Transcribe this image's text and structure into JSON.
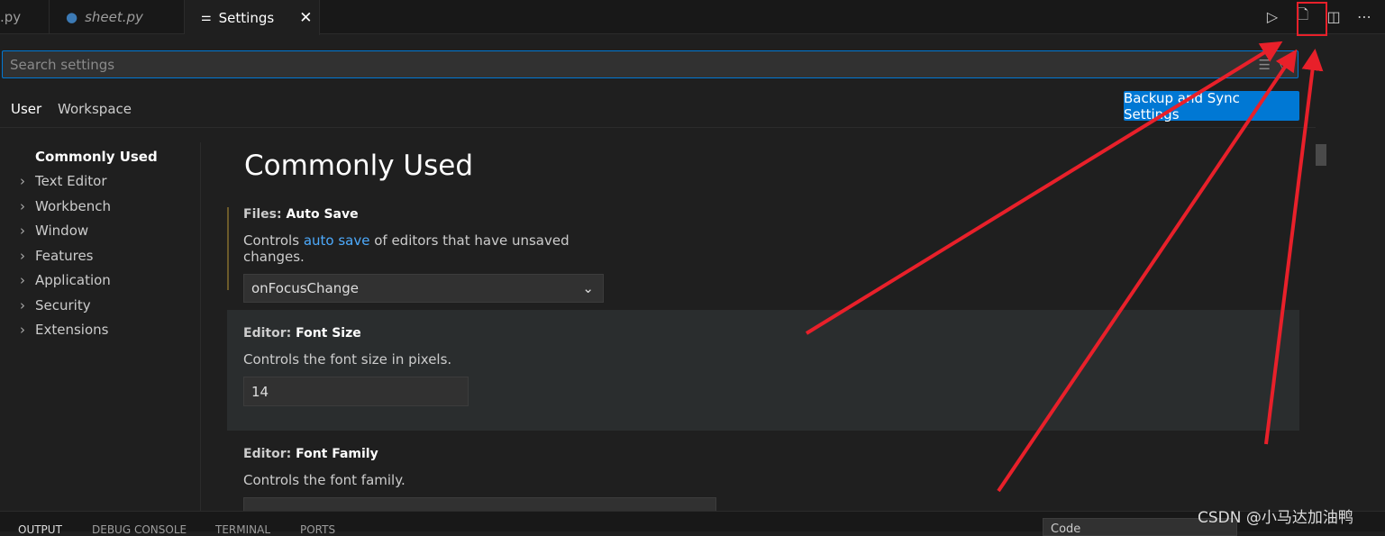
{
  "tabs": [
    {
      "label": ".py",
      "italic": false
    },
    {
      "label": "sheet.py",
      "italic": true,
      "icon": "python-icon"
    },
    {
      "label": "Settings",
      "active": true,
      "icon": "settings-sliders-icon"
    }
  ],
  "editor_actions": [
    "run-icon",
    "open-settings-json-icon",
    "split-editor-icon",
    "more-actions-icon"
  ],
  "search": {
    "placeholder": "Search settings"
  },
  "scopes": {
    "user": "User",
    "workspace": "Workspace"
  },
  "sync_button": "Backup and Sync Settings",
  "toc": [
    "Commonly Used",
    "Text Editor",
    "Workbench",
    "Window",
    "Features",
    "Application",
    "Security",
    "Extensions"
  ],
  "main": {
    "title": "Commonly Used",
    "settings": [
      {
        "category": "Files: ",
        "name": "Auto Save",
        "desc_pre": "Controls ",
        "desc_link": "auto save",
        "desc_post": " of editors that have unsaved changes.",
        "value": "onFocusChange"
      },
      {
        "category": "Editor: ",
        "name": "Font Size",
        "desc": "Controls the font size in pixels.",
        "value": "14"
      },
      {
        "category": "Editor: ",
        "name": "Font Family",
        "desc": "Controls the font family."
      }
    ]
  },
  "panel": {
    "tabs": [
      "OUTPUT",
      "DEBUG CONSOLE",
      "TERMINAL",
      "PORTS"
    ],
    "channel": "Code"
  },
  "watermark": "CSDN @小马达加油鸭",
  "colors": {
    "accent": "#0078d4",
    "annotation": "#e8202a"
  }
}
